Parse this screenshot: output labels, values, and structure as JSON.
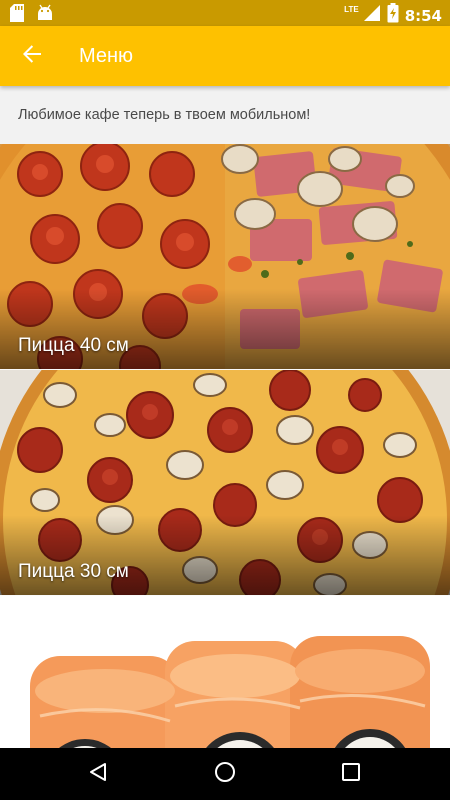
{
  "status_bar": {
    "time": "8:54",
    "network": "LTE",
    "icons": [
      "sd-card-icon",
      "android-icon",
      "signal-icon",
      "battery-charging-icon"
    ]
  },
  "app_bar": {
    "title": "Меню",
    "back_icon": "arrow-left-icon",
    "background": "#fec100"
  },
  "subtitle": "Любимое кафе теперь в твоем мобильном!",
  "menu": {
    "items": [
      {
        "label": "Пицца 40 см",
        "image": "pizza-pepperoni-ham-mushroom-photo"
      },
      {
        "label": "Пицца 30 см",
        "image": "pizza-pepperoni-mushroom-photo"
      },
      {
        "label": "",
        "image": "sushi-rolls-photo"
      }
    ]
  },
  "nav_bar": {
    "icons": [
      "nav-back-icon",
      "nav-home-icon",
      "nav-recents-icon"
    ]
  },
  "colors": {
    "status_bar": "#c99a00",
    "accent": "#fec100",
    "subtitle_bg": "#f2f2f2"
  }
}
